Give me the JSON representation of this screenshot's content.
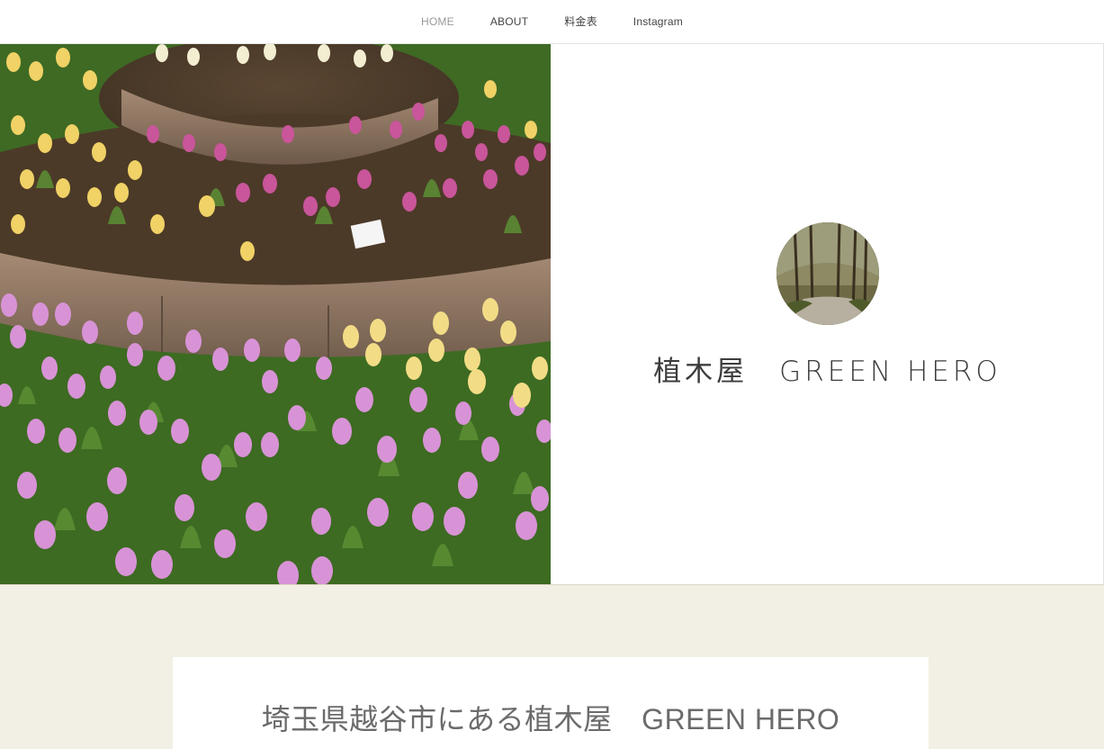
{
  "nav": {
    "items": [
      {
        "label": "HOME",
        "active": true
      },
      {
        "label": "ABOUT",
        "active": false
      },
      {
        "label": "料金表",
        "active": false
      },
      {
        "label": "Instagram",
        "active": false
      }
    ]
  },
  "hero": {
    "image_subject": "tulip-garden-photo",
    "site_title": "植木屋　GREEN HERO",
    "avatar_subject": "forest-path-photo"
  },
  "main": {
    "heading": "埼玉県越谷市にある植木屋　GREEN HERO"
  },
  "colors": {
    "nav_active": "#999999",
    "nav_text": "#444444",
    "section_bg": "#f2efe4",
    "title_text": "#3c3c3c",
    "heading_text": "#6b6b6b"
  }
}
